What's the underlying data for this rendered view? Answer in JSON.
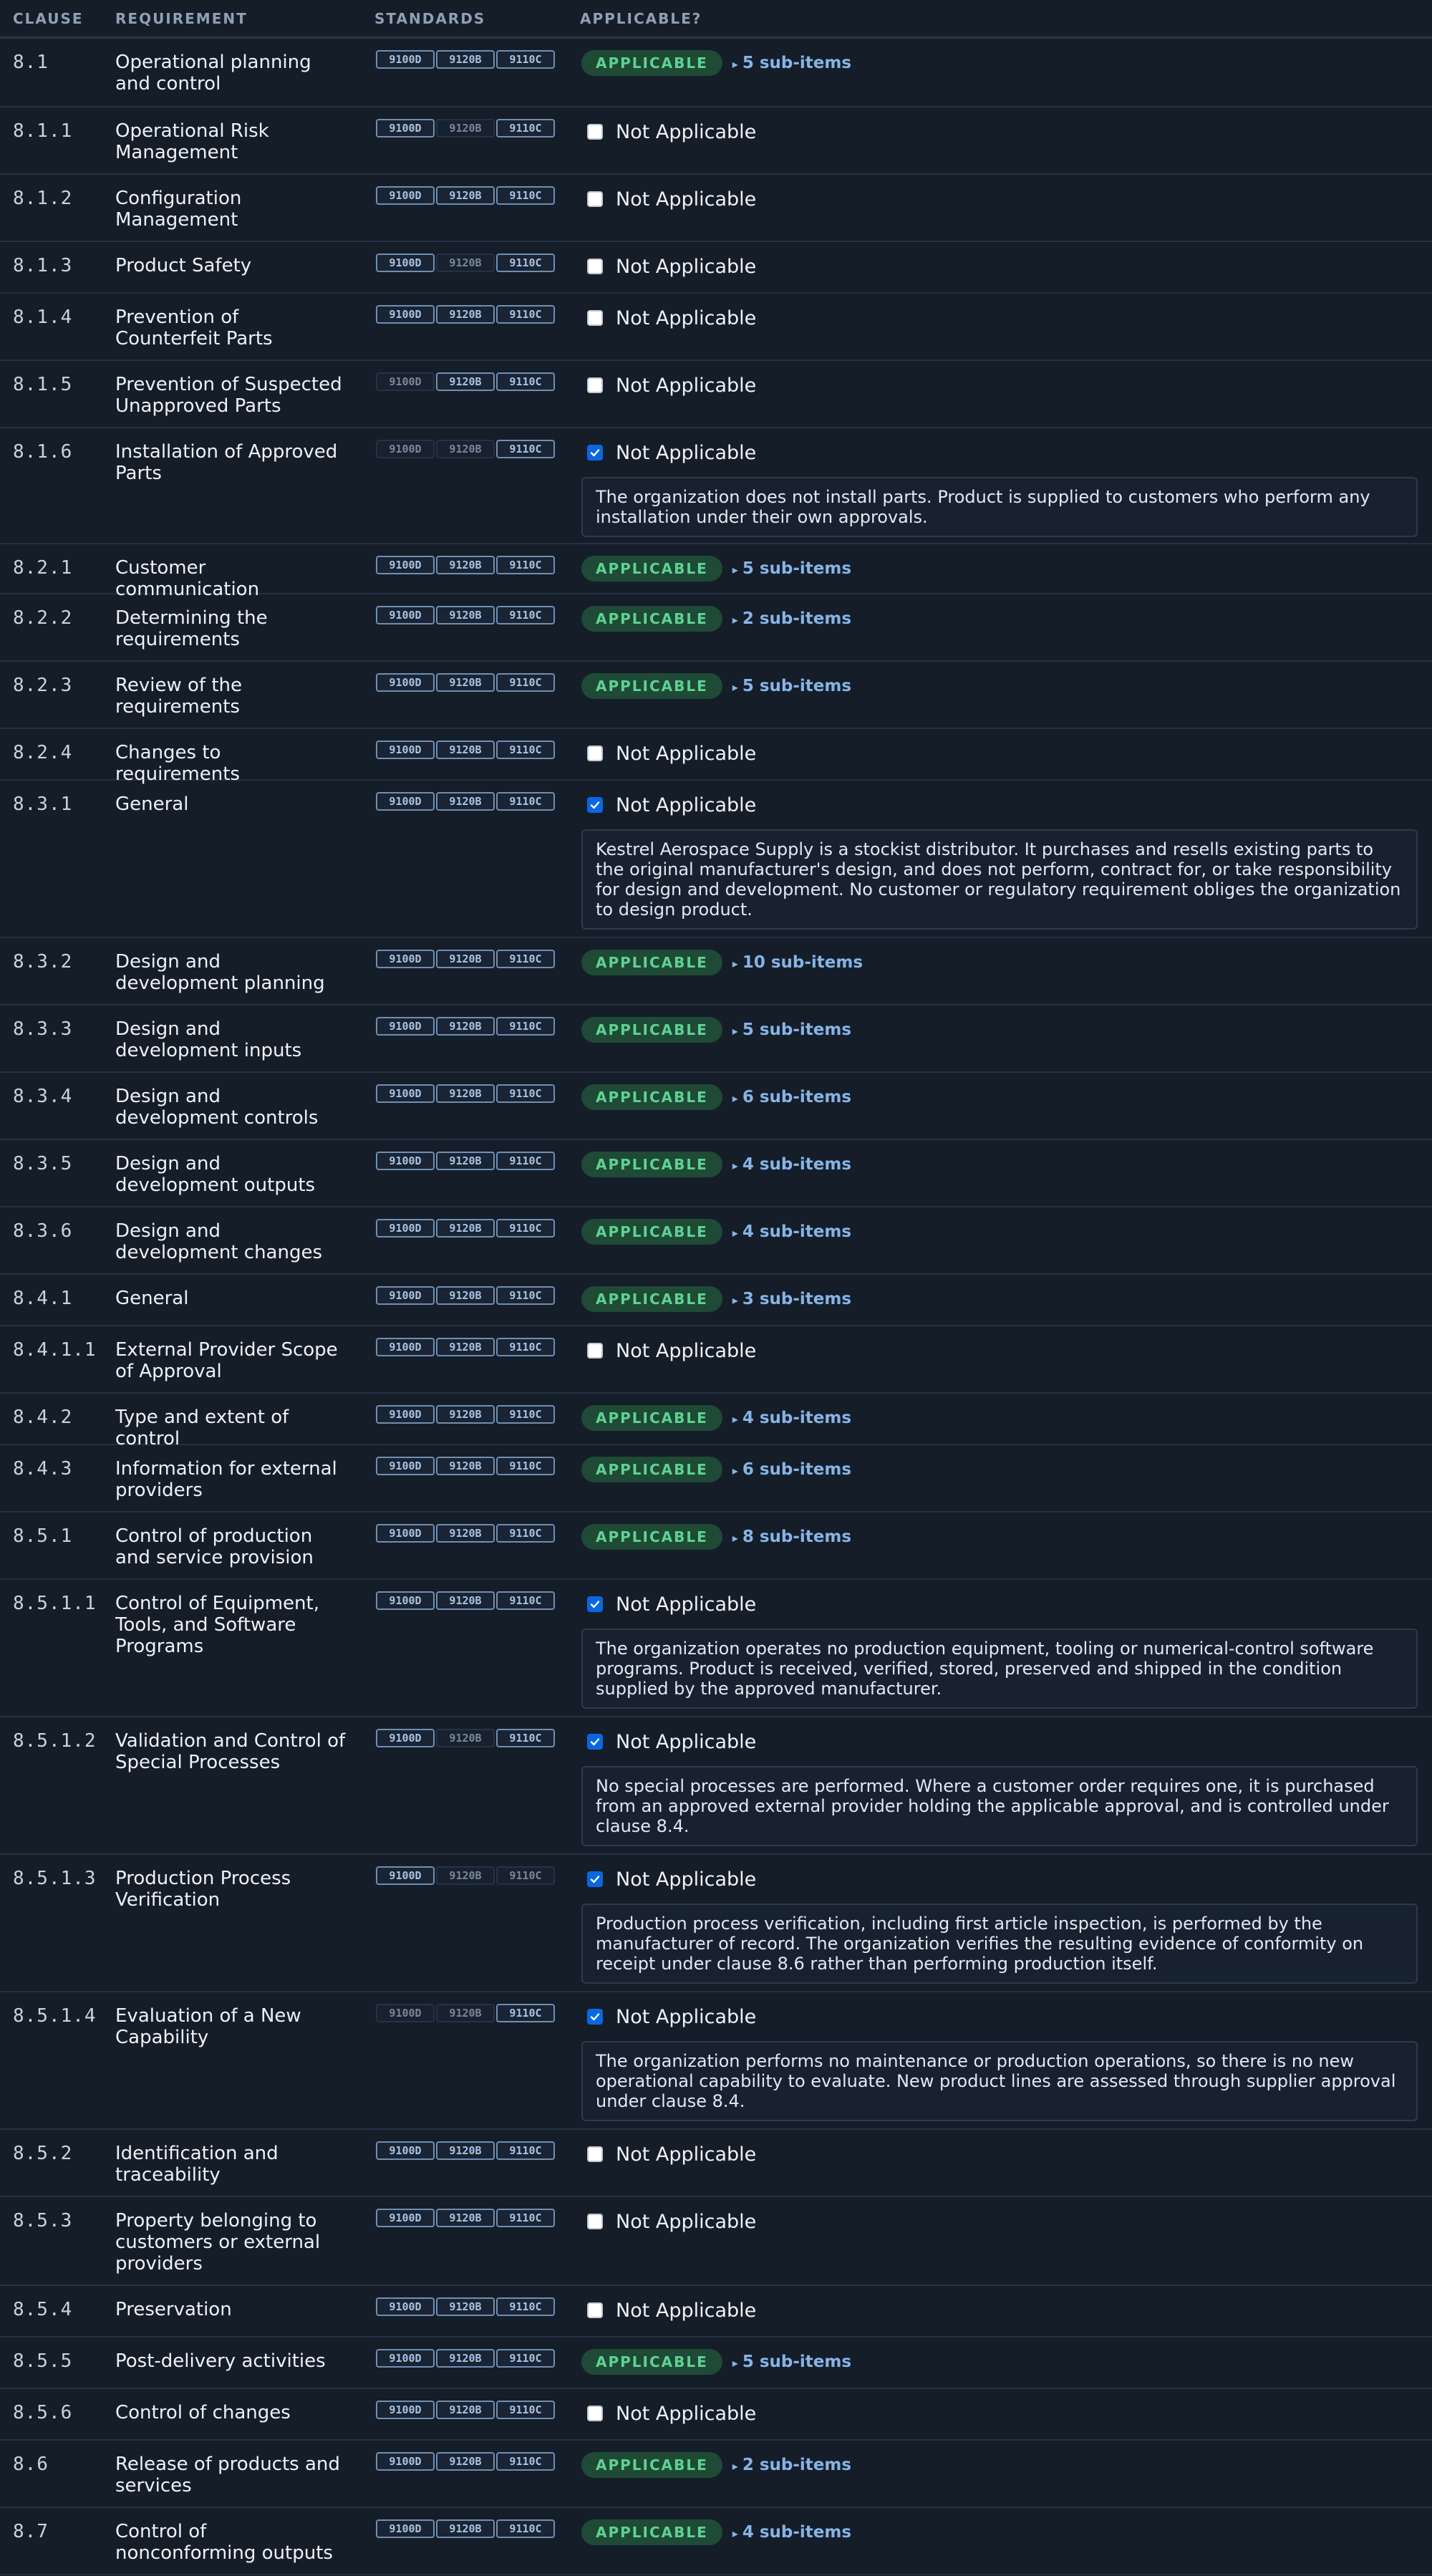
{
  "header": {
    "clause": "CLAUSE",
    "requirement": "REQUIREMENT",
    "standards": "STANDARDS",
    "applicable": "APPLICABLE?"
  },
  "labels": {
    "applicable": "APPLICABLE",
    "not_applicable": "Not Applicable"
  },
  "colors": {
    "background": "#151d29",
    "applicable_pill": "#1e4a36",
    "applicable_text": "#5fd291",
    "subitems_link": "#86b4e6",
    "badge_active": "#6f8fb4",
    "checkbox_checked": "#0a67e2"
  },
  "rows": [
    {
      "clause": "8.1",
      "requirement": "Operational planning and control",
      "standards": [
        true,
        true,
        true
      ],
      "status": "applicable",
      "subitems": "5 sub-items"
    },
    {
      "clause": "8.1.1",
      "requirement": "Operational Risk Management",
      "standards": [
        true,
        false,
        true
      ],
      "status": "na",
      "checked": false
    },
    {
      "clause": "8.1.2",
      "requirement": "Configuration Management",
      "standards": [
        true,
        true,
        true
      ],
      "status": "na",
      "checked": false
    },
    {
      "clause": "8.1.3",
      "requirement": "Product Safety",
      "standards": [
        true,
        false,
        true
      ],
      "status": "na",
      "checked": false
    },
    {
      "clause": "8.1.4",
      "requirement": "Prevention of Counterfeit Parts",
      "standards": [
        true,
        true,
        true
      ],
      "status": "na",
      "checked": false
    },
    {
      "clause": "8.1.5",
      "requirement": "Prevention of Suspected Unapproved Parts",
      "standards": [
        false,
        true,
        true
      ],
      "status": "na",
      "checked": false
    },
    {
      "clause": "8.1.6",
      "requirement": "Installation of Approved Parts",
      "standards": [
        false,
        false,
        true
      ],
      "status": "na",
      "checked": true,
      "reason": "The organization does not install parts. Product is supplied to customers who perform any installation under their own approvals."
    },
    {
      "clause": "8.2.1",
      "requirement": "Customer communication",
      "standards": [
        true,
        true,
        true
      ],
      "status": "applicable",
      "subitems": "5 sub-items"
    },
    {
      "clause": "8.2.2",
      "requirement": "Determining the requirements",
      "standards": [
        true,
        true,
        true
      ],
      "status": "applicable",
      "subitems": "2 sub-items"
    },
    {
      "clause": "8.2.3",
      "requirement": "Review of the requirements",
      "standards": [
        true,
        true,
        true
      ],
      "status": "applicable",
      "subitems": "5 sub-items"
    },
    {
      "clause": "8.2.4",
      "requirement": "Changes to requirements",
      "standards": [
        true,
        true,
        true
      ],
      "status": "na",
      "checked": false
    },
    {
      "clause": "8.3.1",
      "requirement": "General",
      "standards": [
        true,
        true,
        true
      ],
      "status": "na",
      "checked": true,
      "reason": "Kestrel Aerospace Supply is a stockist distributor. It purchases and resells existing parts to the original manufacturer's design, and does not perform, contract for, or take responsibility for design and development. No customer or regulatory requirement obliges the organization to design product."
    },
    {
      "clause": "8.3.2",
      "requirement": "Design and development planning",
      "standards": [
        true,
        true,
        true
      ],
      "status": "applicable",
      "subitems": "10 sub-items"
    },
    {
      "clause": "8.3.3",
      "requirement": "Design and development inputs",
      "standards": [
        true,
        true,
        true
      ],
      "status": "applicable",
      "subitems": "5 sub-items"
    },
    {
      "clause": "8.3.4",
      "requirement": "Design and development controls",
      "standards": [
        true,
        true,
        true
      ],
      "status": "applicable",
      "subitems": "6 sub-items"
    },
    {
      "clause": "8.3.5",
      "requirement": "Design and development outputs",
      "standards": [
        true,
        true,
        true
      ],
      "status": "applicable",
      "subitems": "4 sub-items"
    },
    {
      "clause": "8.3.6",
      "requirement": "Design and development changes",
      "standards": [
        true,
        true,
        true
      ],
      "status": "applicable",
      "subitems": "4 sub-items"
    },
    {
      "clause": "8.4.1",
      "requirement": "General",
      "standards": [
        true,
        true,
        true
      ],
      "status": "applicable",
      "subitems": "3 sub-items"
    },
    {
      "clause": "8.4.1.1",
      "requirement": "External Provider Scope of Approval",
      "standards": [
        true,
        true,
        true
      ],
      "status": "na",
      "checked": false
    },
    {
      "clause": "8.4.2",
      "requirement": "Type and extent of control",
      "standards": [
        true,
        true,
        true
      ],
      "status": "applicable",
      "subitems": "4 sub-items"
    },
    {
      "clause": "8.4.3",
      "requirement": "Information for external providers",
      "standards": [
        true,
        true,
        true
      ],
      "status": "applicable",
      "subitems": "6 sub-items"
    },
    {
      "clause": "8.5.1",
      "requirement": "Control of production and service provision",
      "standards": [
        true,
        true,
        true
      ],
      "status": "applicable",
      "subitems": "8 sub-items"
    },
    {
      "clause": "8.5.1.1",
      "requirement": "Control of Equipment, Tools, and Software Programs",
      "standards": [
        true,
        true,
        true
      ],
      "status": "na",
      "checked": true,
      "reason": "The organization operates no production equipment, tooling or numerical-control software programs. Product is received, verified, stored, preserved and shipped in the condition supplied by the approved manufacturer."
    },
    {
      "clause": "8.5.1.2",
      "requirement": "Validation and Control of Special Processes",
      "standards": [
        true,
        false,
        true
      ],
      "status": "na",
      "checked": true,
      "reason": "No special processes are performed. Where a customer order requires one, it is purchased from an approved external provider holding the applicable approval, and is controlled under clause 8.4."
    },
    {
      "clause": "8.5.1.3",
      "requirement": "Production Process Verification",
      "standards": [
        true,
        false,
        false
      ],
      "status": "na",
      "checked": true,
      "reason": "Production process verification, including first article inspection, is performed by the manufacturer of record. The organization verifies the resulting evidence of conformity on receipt under clause 8.6 rather than performing production itself."
    },
    {
      "clause": "8.5.1.4",
      "requirement": "Evaluation of a New Capability",
      "standards": [
        false,
        false,
        true
      ],
      "status": "na",
      "checked": true,
      "reason": "The organization performs no maintenance or production operations, so there is no new operational capability to evaluate. New product lines are assessed through supplier approval under clause 8.4."
    },
    {
      "clause": "8.5.2",
      "requirement": "Identification and traceability",
      "standards": [
        true,
        true,
        true
      ],
      "status": "na",
      "checked": false
    },
    {
      "clause": "8.5.3",
      "requirement": "Property belonging to customers or external providers",
      "standards": [
        true,
        true,
        true
      ],
      "status": "na",
      "checked": false
    },
    {
      "clause": "8.5.4",
      "requirement": "Preservation",
      "standards": [
        true,
        true,
        true
      ],
      "status": "na",
      "checked": false
    },
    {
      "clause": "8.5.5",
      "requirement": "Post-delivery activities",
      "standards": [
        true,
        true,
        true
      ],
      "status": "applicable",
      "subitems": "5 sub-items"
    },
    {
      "clause": "8.5.6",
      "requirement": "Control of changes",
      "standards": [
        true,
        true,
        true
      ],
      "status": "na",
      "checked": false
    },
    {
      "clause": "8.6",
      "requirement": "Release of products and services",
      "standards": [
        true,
        true,
        true
      ],
      "status": "applicable",
      "subitems": "2 sub-items"
    },
    {
      "clause": "8.7",
      "requirement": "Control of nonconforming outputs",
      "standards": [
        true,
        true,
        true
      ],
      "status": "applicable",
      "subitems": "4 sub-items"
    }
  ],
  "standard_names": [
    "9100D",
    "9120B",
    "9110C"
  ]
}
